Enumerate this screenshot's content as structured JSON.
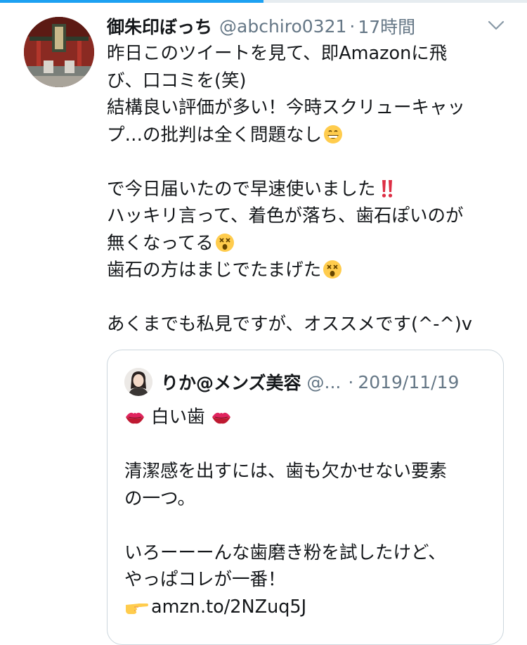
{
  "tweet": {
    "display_name": "御朱印ぼっち",
    "handle": "@abchiro0321",
    "separator": "·",
    "time": "17時間",
    "lines": {
      "l1": "昨日このツイートを見て、即Amazonに飛",
      "l2": "び、口コミを(笑)",
      "l3": "結構良い評価が多い！今時スクリューキャッ",
      "l4": "プ…の批判は全く問題なし",
      "l6": "で今日届いたので早速使いました",
      "l7": "ハッキリ言って、着色が落ち、歯石ぽいのが",
      "l8": "無くなってる",
      "l9": "歯石の方はまじでたまげた",
      "l11": "あくまでも私見ですが、オススメです(^-^)v"
    },
    "icons": {
      "menu": "chevron-down-icon",
      "grin": "grinning-face-emoji",
      "exclaim": "double-exclamation-emoji",
      "dizzy": "dizzy-face-emoji"
    }
  },
  "quote": {
    "display_name": "りか@メンズ美容",
    "handle": "@...",
    "separator": "·",
    "date": "2019/11/19",
    "lines": {
      "l1": "白い歯",
      "l3": "清潔感を出すには、歯も欠かせない要素",
      "l4": "の一つ。",
      "l6": "いろーーーんな歯磨き粉を試したけど、",
      "l7": "やっぱコレが一番！",
      "link": "amzn.to/2NZuq5J"
    },
    "icons": {
      "lips": "kiss-mark-emoji",
      "hand": "pointing-hand-emoji"
    }
  },
  "colors": {
    "accent": "#1da1f2",
    "text": "#14171a",
    "muted": "#657786",
    "border": "#ccd6dd"
  },
  "progress": 0.5
}
